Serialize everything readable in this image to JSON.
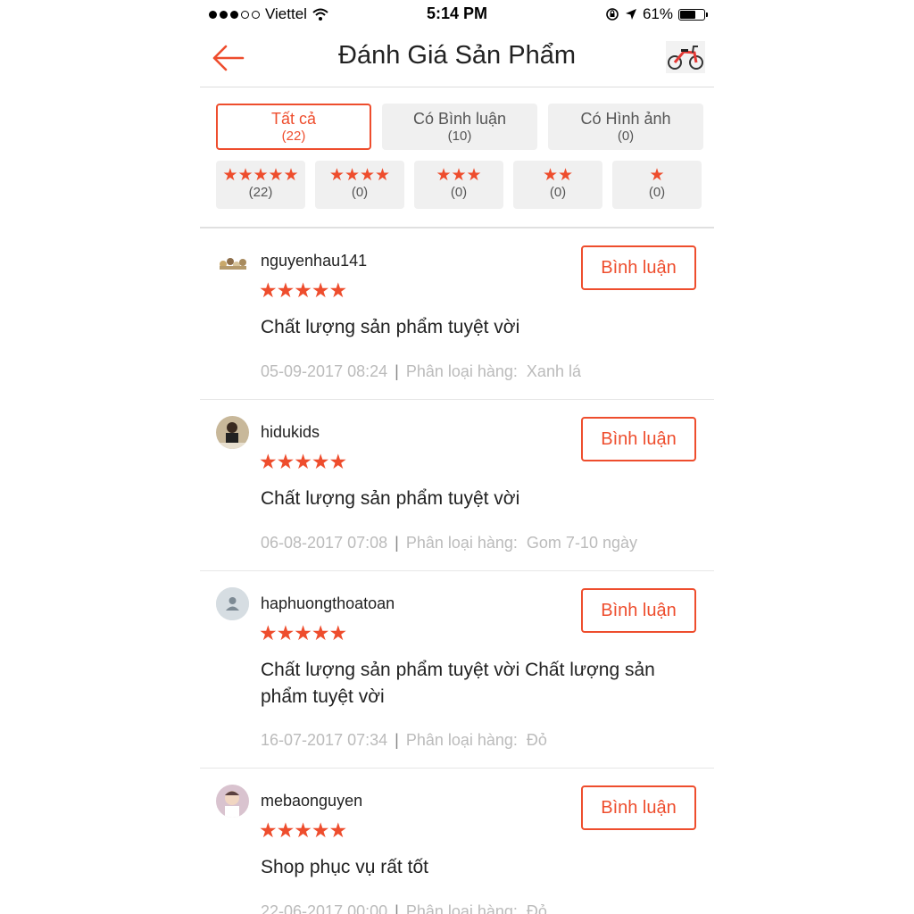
{
  "status_bar": {
    "carrier": "Viettel",
    "time": "5:14 PM",
    "battery": "61%"
  },
  "header": {
    "title": "Đánh Giá Sản Phẩm"
  },
  "filters": {
    "row1": [
      {
        "label": "Tất cả",
        "count": "(22)"
      },
      {
        "label": "Có Bình luận",
        "count": "(10)"
      },
      {
        "label": "Có Hình ảnh",
        "count": "(0)"
      }
    ],
    "row2": [
      {
        "stars": "★★★★★",
        "count": "(22)"
      },
      {
        "stars": "★★★★",
        "count": "(0)"
      },
      {
        "stars": "★★★",
        "count": "(0)"
      },
      {
        "stars": "★★",
        "count": "(0)"
      },
      {
        "stars": "★",
        "count": "(0)"
      }
    ]
  },
  "category_label": "Phân loại hàng:",
  "reply_label": "Bình luận",
  "reviews": [
    {
      "user": "nguyenhau141",
      "stars": "★★★★★",
      "comment": "Chất lượng sản phẩm tuyệt vời",
      "date": "05-09-2017 08:24",
      "variant": "Xanh lá"
    },
    {
      "user": "hidukids",
      "stars": "★★★★★",
      "comment": "Chất lượng sản phẩm tuyệt vời",
      "date": "06-08-2017 07:08",
      "variant": "Gom 7-10 ngày"
    },
    {
      "user": "haphuongthoatoan",
      "stars": "★★★★★",
      "comment": "Chất lượng sản phẩm tuyệt vời Chất lượng sản phẩm tuyệt vời",
      "date": "16-07-2017 07:34",
      "variant": "Đỏ"
    },
    {
      "user": "mebaonguyen",
      "stars": "★★★★★",
      "comment": "Shop phục vụ rất tốt",
      "date": "22-06-2017 00:00",
      "variant": "Đỏ"
    }
  ],
  "colors": {
    "accent": "#ee4d2d",
    "muted": "#bbbbbb"
  }
}
